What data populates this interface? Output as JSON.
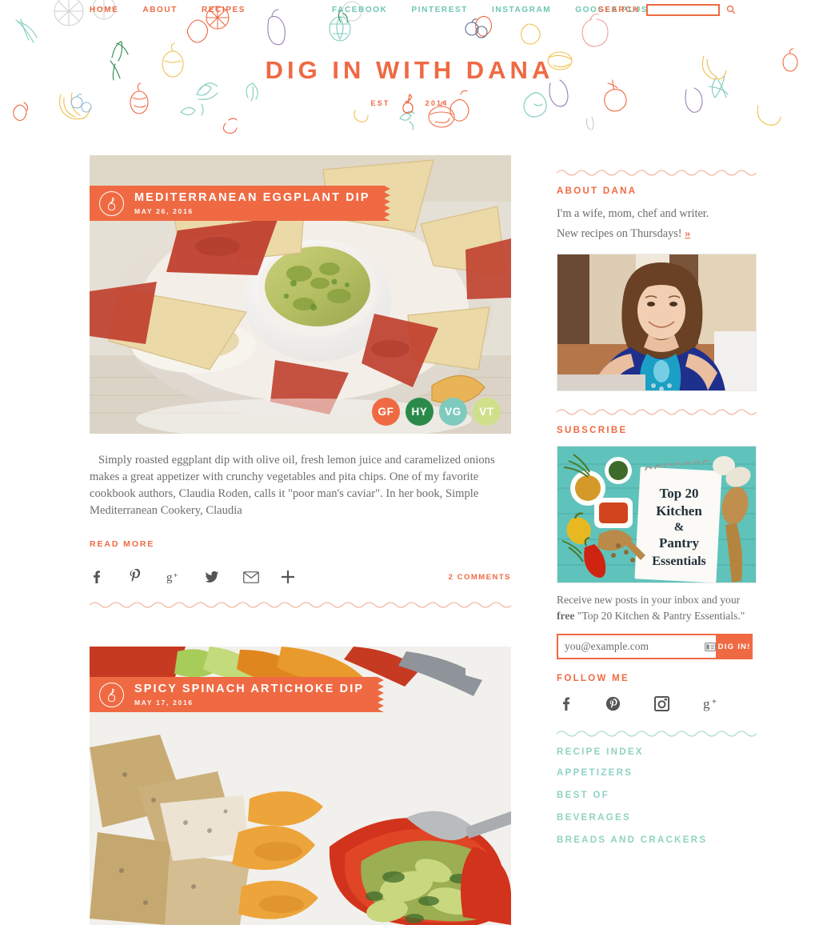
{
  "header": {
    "nav_primary": [
      {
        "label": "HOME",
        "name": "nav-home"
      },
      {
        "label": "ABOUT",
        "name": "nav-about"
      },
      {
        "label": "RECIPES",
        "name": "nav-recipes"
      }
    ],
    "nav_social": [
      {
        "label": "FACEBOOK",
        "name": "nav-facebook"
      },
      {
        "label": "PINTEREST",
        "name": "nav-pinterest"
      },
      {
        "label": "INSTAGRAM",
        "name": "nav-instagram"
      },
      {
        "label": "GOOGLE PLUS",
        "name": "nav-google-plus"
      }
    ],
    "search_label": "SEARCH",
    "search_value": "",
    "search_placeholder": "",
    "brand_title": "DIG IN WITH DANA",
    "established_prefix": "EST",
    "established_year": "2014",
    "accent_color": "#ef6a43",
    "teal_color": "#6fc6b2"
  },
  "posts": [
    {
      "title": "MEDITERRANEAN EGGPLANT DIP",
      "date": "MAY 26, 2016",
      "badges": [
        {
          "label": "GF",
          "color": "#ef6a43"
        },
        {
          "label": "HY",
          "color": "#2a8a4a"
        },
        {
          "label": "VG",
          "color": "#7ecbbd"
        },
        {
          "label": "VT",
          "color": "#cfe08a"
        }
      ],
      "excerpt": "Simply roasted eggplant dip with olive oil, fresh lemon juice and caramelized onions makes a great appetizer with crunchy vegetables and pita chips. One of my favorite cookbook authors, Claudia Roden, calls it \"poor man's caviar\". In her book, Simple Mediterranean Cookery, Claudia",
      "read_more": "READ MORE",
      "comments": "2 COMMENTS",
      "share": [
        {
          "name": "share-facebook-icon",
          "glyph": "f"
        },
        {
          "name": "share-pinterest-icon",
          "glyph": "P"
        },
        {
          "name": "share-google-plus-icon",
          "glyph": "g+"
        },
        {
          "name": "share-twitter-icon",
          "glyph": "t"
        },
        {
          "name": "share-email-icon",
          "glyph": "mail"
        },
        {
          "name": "share-more-icon",
          "glyph": "+"
        }
      ]
    },
    {
      "title": "SPICY SPINACH ARTICHOKE DIP",
      "date": "MAY 17, 2016"
    }
  ],
  "sidebar": {
    "about": {
      "heading": "ABOUT DANA",
      "line1": "I'm a wife, mom, chef and writer.",
      "line2": "New recipes on Thursdays!",
      "chevrons": "»"
    },
    "subscribe": {
      "heading": "SUBSCRIBE",
      "promo_image_lines": [
        "Top 20",
        "Kitchen",
        "&",
        "Pantry",
        "Essentials"
      ],
      "copy_part1": "Receive new posts in your inbox and your ",
      "copy_bold": "free",
      "copy_part2": " \"Top 20 Kitchen & Pantry Essentials.\"",
      "input_placeholder": "you@example.com",
      "input_value": "",
      "button_label": "DIG IN!"
    },
    "follow": {
      "heading": "FOLLOW ME",
      "icons": [
        {
          "name": "follow-facebook-icon"
        },
        {
          "name": "follow-pinterest-icon"
        },
        {
          "name": "follow-instagram-icon"
        },
        {
          "name": "follow-google-plus-icon"
        }
      ]
    },
    "recipe_index": {
      "heading": "RECIPE INDEX",
      "items": [
        {
          "label": "APPETIZERS"
        },
        {
          "label": "BEST OF"
        },
        {
          "label": "BEVERAGES"
        },
        {
          "label": "BREADS AND CRACKERS"
        }
      ]
    }
  }
}
